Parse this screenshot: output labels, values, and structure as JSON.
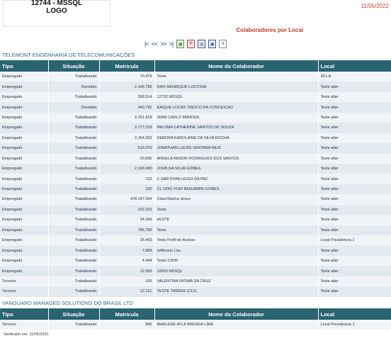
{
  "header": {
    "logo_line1": "12744 - MSSQL",
    "logo_line2": "LOGO",
    "date": "11/05/2022",
    "report_title": "Colaboradores por Local"
  },
  "toolbar": {
    "first": "|<",
    "prev": "<<",
    "next": ">>",
    "last": ">|",
    "icons": [
      "excel-export-icon",
      "pdf-export-icon",
      "calendar-icon",
      "print-icon",
      "document-icon"
    ]
  },
  "columns": {
    "tipo": "Tipo",
    "situacao": "Situação",
    "matricula": "Matricula",
    "nome": "Nome do Colaborador",
    "local": "Local"
  },
  "companies": [
    {
      "name": "TELEMONT ENGENHARIA DE TELECOMUNICAÇÕES",
      "rows": [
        {
          "tipo": "Empregado",
          "situacao": "Trabalhando",
          "matricula": "70.479",
          "nome": "Teste",
          "local": "251-A"
        },
        {
          "tipo": "Empregado",
          "situacao": "Demitido",
          "matricula": "2.148.795",
          "nome": "DAVI HENRIQUE LUSTOSA",
          "local": "Teste alter"
        },
        {
          "tipo": "Empregado",
          "situacao": "Trabalhando",
          "matricula": "398.514",
          "nome": "12732 MSSQL",
          "local": "Teste alter"
        },
        {
          "tipo": "Empregado",
          "situacao": "Demitido",
          "matricula": "440.792",
          "nome": "KAIQUE LUCAS TINOCO DA CONCEICAO",
          "local": "Teste alter"
        },
        {
          "tipo": "Empregado",
          "situacao": "Trabalhando",
          "matricula": "2.151.918",
          "nome": "JEAN CARLO MIRASOL",
          "local": "Teste alter"
        },
        {
          "tipo": "Empregado",
          "situacao": "Trabalhando",
          "matricula": "2.177.018",
          "nome": "PALOMA CATHERINE SANTOS DE SOUZA",
          "local": "Teste alter"
        },
        {
          "tipo": "Empregado",
          "situacao": "Trabalhando",
          "matricula": "2.164.092",
          "nome": "DEBORA KAROLAINE DA SILVA ROCHA",
          "local": "Teste alter"
        },
        {
          "tipo": "Empregado",
          "situacao": "Trabalhando",
          "matricula": "510.370",
          "nome": "JONATHAN LUCAS SANTANA REIS",
          "local": "Teste alter"
        },
        {
          "tipo": "Empregado",
          "situacao": "Trabalhando",
          "matricula": "20.836",
          "nome": "ANGELA RENOR RODRIGUES DOS SANTOS",
          "local": "Teste alter"
        },
        {
          "tipo": "Empregado",
          "situacao": "Trabalhando",
          "matricula": "2.199.483",
          "nome": "JOHN DA SILVA GOMES",
          "local": "Teste alter"
        },
        {
          "tipo": "Empregado",
          "situacao": "Trabalhando",
          "matricula": "119",
          "nome": "C SAR RYAN HUGO DA PAZ",
          "local": "Teste alter"
        },
        {
          "tipo": "Empregado",
          "situacao": "Trabalhando",
          "matricula": "120",
          "nome": "CL UDIO YURI BENJAMIN GOMES",
          "local": "Teste alter"
        },
        {
          "tipo": "Empregado",
          "situacao": "Trabalhando",
          "matricula": "478.147.004",
          "nome": "Clara Marina Jesus",
          "local": "Teste alter"
        },
        {
          "tipo": "Empregado",
          "situacao": "Trabalhando",
          "matricula": "232.323",
          "nome": "Teste",
          "local": "Teste alter"
        },
        {
          "tipo": "Empregado",
          "situacao": "Trabalhando",
          "matricula": "34.343",
          "nome": "trESTE",
          "local": "Teste alter"
        },
        {
          "tipo": "Empregado",
          "situacao": "Trabalhando",
          "matricula": "786.756",
          "nome": "Teste",
          "local": "Teste alter"
        },
        {
          "tipo": "Empregado",
          "situacao": "Trabalhando",
          "matricula": "35.463",
          "nome": "Teste Perfil de Acesso",
          "local": "Local Presidencia 1"
        },
        {
          "tipo": "Empregado",
          "situacao": "Trabalhando",
          "matricula": "7.868",
          "nome": "Jefferson Lira",
          "local": "Teste alter"
        },
        {
          "tipo": "Empregado",
          "situacao": "Trabalhando",
          "matricula": "4.444",
          "nome": "Teste 12650",
          "local": "Teste alter"
        },
        {
          "tipo": "Empregado",
          "situacao": "Trabalhando",
          "matricula": "12.693",
          "nome": "12693 MSSQL",
          "local": "Teste alter"
        },
        {
          "tipo": "Terceiro",
          "situacao": "Trabalhando",
          "matricula": "100",
          "nome": "VALENTINA FATIMA DA CRUZ",
          "local": "Teste alter"
        },
        {
          "tipo": "Terceiro",
          "situacao": "Trabalhando",
          "matricula": "12.121",
          "nome": "TESTE TAREFA 12121",
          "local": "Teste alter"
        }
      ]
    },
    {
      "name": "VANGUARD MANAGED SOLUTIONS DO BRASIL LTD",
      "rows": [
        {
          "tipo": "Terceiro",
          "situacao": "Trabalhando",
          "matricula": "890",
          "nome": "MARLENE AYLA BRENDA LIMA",
          "local": "Local Presidencia 1"
        }
      ]
    }
  ],
  "footer": "Verificado em: 11/05/2022"
}
